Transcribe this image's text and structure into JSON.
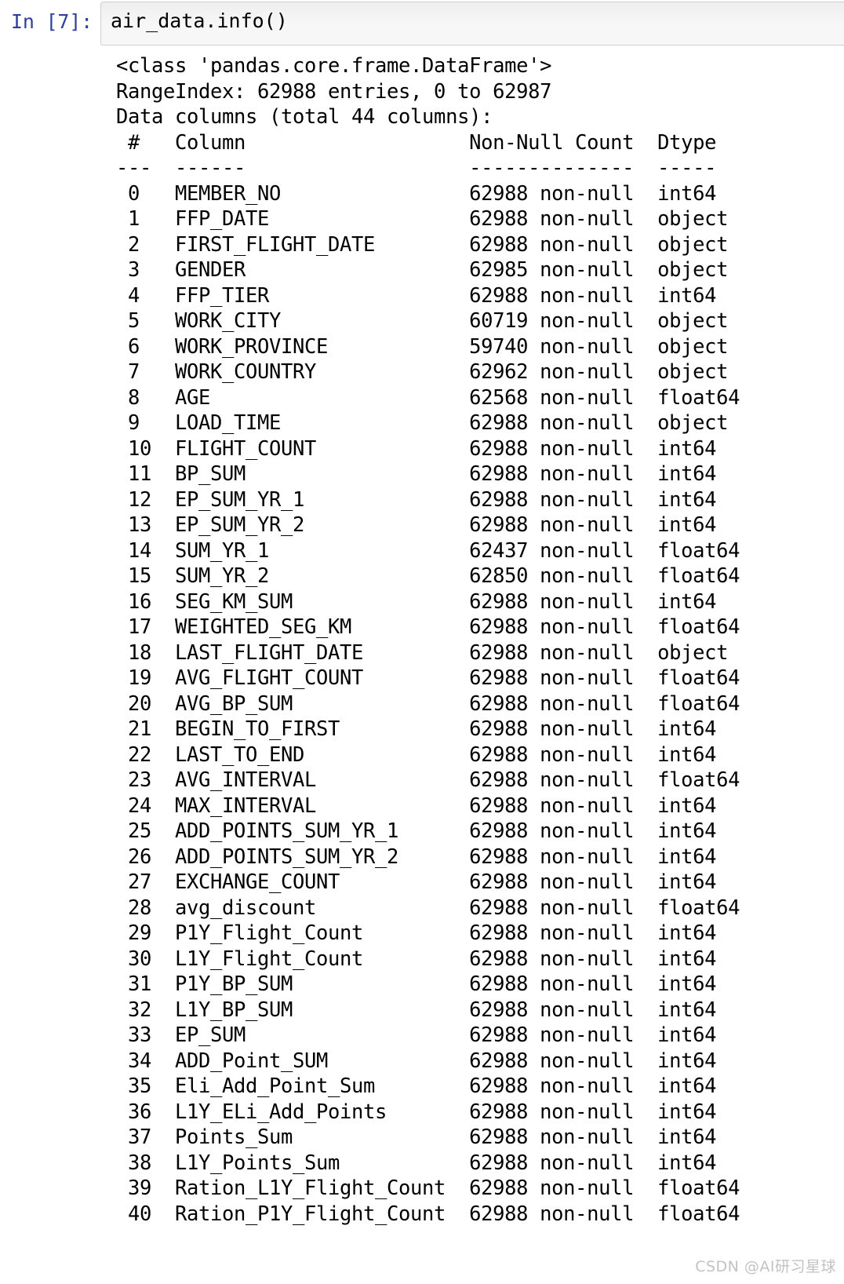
{
  "cell": {
    "prompt_label": "In [7]:",
    "prompt_color": "#303f9f",
    "input_code": "air_data.info()"
  },
  "output": {
    "header_lines": [
      "<class 'pandas.core.frame.DataFrame'>",
      "RangeIndex: 62988 entries, 0 to 62987",
      "Data columns (total 44 columns):"
    ],
    "table_header": " #   Column                  Non-Null Count  Dtype  ",
    "table_rule": "---  ------                  --------------  -----  ",
    "columns_header_labels": [
      "#",
      "Column",
      "Non-Null Count",
      "Dtype"
    ],
    "rows": [
      {
        "index": "0",
        "column": "MEMBER_NO",
        "non_null": "62988 non-null",
        "dtype": "int64"
      },
      {
        "index": "1",
        "column": "FFP_DATE",
        "non_null": "62988 non-null",
        "dtype": "object"
      },
      {
        "index": "2",
        "column": "FIRST_FLIGHT_DATE",
        "non_null": "62988 non-null",
        "dtype": "object"
      },
      {
        "index": "3",
        "column": "GENDER",
        "non_null": "62985 non-null",
        "dtype": "object"
      },
      {
        "index": "4",
        "column": "FFP_TIER",
        "non_null": "62988 non-null",
        "dtype": "int64"
      },
      {
        "index": "5",
        "column": "WORK_CITY",
        "non_null": "60719 non-null",
        "dtype": "object"
      },
      {
        "index": "6",
        "column": "WORK_PROVINCE",
        "non_null": "59740 non-null",
        "dtype": "object"
      },
      {
        "index": "7",
        "column": "WORK_COUNTRY",
        "non_null": "62962 non-null",
        "dtype": "object"
      },
      {
        "index": "8",
        "column": "AGE",
        "non_null": "62568 non-null",
        "dtype": "float64"
      },
      {
        "index": "9",
        "column": "LOAD_TIME",
        "non_null": "62988 non-null",
        "dtype": "object"
      },
      {
        "index": "10",
        "column": "FLIGHT_COUNT",
        "non_null": "62988 non-null",
        "dtype": "int64"
      },
      {
        "index": "11",
        "column": "BP_SUM",
        "non_null": "62988 non-null",
        "dtype": "int64"
      },
      {
        "index": "12",
        "column": "EP_SUM_YR_1",
        "non_null": "62988 non-null",
        "dtype": "int64"
      },
      {
        "index": "13",
        "column": "EP_SUM_YR_2",
        "non_null": "62988 non-null",
        "dtype": "int64"
      },
      {
        "index": "14",
        "column": "SUM_YR_1",
        "non_null": "62437 non-null",
        "dtype": "float64"
      },
      {
        "index": "15",
        "column": "SUM_YR_2",
        "non_null": "62850 non-null",
        "dtype": "float64"
      },
      {
        "index": "16",
        "column": "SEG_KM_SUM",
        "non_null": "62988 non-null",
        "dtype": "int64"
      },
      {
        "index": "17",
        "column": "WEIGHTED_SEG_KM",
        "non_null": "62988 non-null",
        "dtype": "float64"
      },
      {
        "index": "18",
        "column": "LAST_FLIGHT_DATE",
        "non_null": "62988 non-null",
        "dtype": "object"
      },
      {
        "index": "19",
        "column": "AVG_FLIGHT_COUNT",
        "non_null": "62988 non-null",
        "dtype": "float64"
      },
      {
        "index": "20",
        "column": "AVG_BP_SUM",
        "non_null": "62988 non-null",
        "dtype": "float64"
      },
      {
        "index": "21",
        "column": "BEGIN_TO_FIRST",
        "non_null": "62988 non-null",
        "dtype": "int64"
      },
      {
        "index": "22",
        "column": "LAST_TO_END",
        "non_null": "62988 non-null",
        "dtype": "int64"
      },
      {
        "index": "23",
        "column": "AVG_INTERVAL",
        "non_null": "62988 non-null",
        "dtype": "float64"
      },
      {
        "index": "24",
        "column": "MAX_INTERVAL",
        "non_null": "62988 non-null",
        "dtype": "int64"
      },
      {
        "index": "25",
        "column": "ADD_POINTS_SUM_YR_1",
        "non_null": "62988 non-null",
        "dtype": "int64"
      },
      {
        "index": "26",
        "column": "ADD_POINTS_SUM_YR_2",
        "non_null": "62988 non-null",
        "dtype": "int64"
      },
      {
        "index": "27",
        "column": "EXCHANGE_COUNT",
        "non_null": "62988 non-null",
        "dtype": "int64"
      },
      {
        "index": "28",
        "column": "avg_discount",
        "non_null": "62988 non-null",
        "dtype": "float64"
      },
      {
        "index": "29",
        "column": "P1Y_Flight_Count",
        "non_null": "62988 non-null",
        "dtype": "int64"
      },
      {
        "index": "30",
        "column": "L1Y_Flight_Count",
        "non_null": "62988 non-null",
        "dtype": "int64"
      },
      {
        "index": "31",
        "column": "P1Y_BP_SUM",
        "non_null": "62988 non-null",
        "dtype": "int64"
      },
      {
        "index": "32",
        "column": "L1Y_BP_SUM",
        "non_null": "62988 non-null",
        "dtype": "int64"
      },
      {
        "index": "33",
        "column": "EP_SUM",
        "non_null": "62988 non-null",
        "dtype": "int64"
      },
      {
        "index": "34",
        "column": "ADD_Point_SUM",
        "non_null": "62988 non-null",
        "dtype": "int64"
      },
      {
        "index": "35",
        "column": "Eli_Add_Point_Sum",
        "non_null": "62988 non-null",
        "dtype": "int64"
      },
      {
        "index": "36",
        "column": "L1Y_ELi_Add_Points",
        "non_null": "62988 non-null",
        "dtype": "int64"
      },
      {
        "index": "37",
        "column": "Points_Sum",
        "non_null": "62988 non-null",
        "dtype": "int64"
      },
      {
        "index": "38",
        "column": "L1Y_Points_Sum",
        "non_null": "62988 non-null",
        "dtype": "int64"
      },
      {
        "index": "39",
        "column": "Ration_L1Y_Flight_Count",
        "non_null": "62988 non-null",
        "dtype": "float64"
      },
      {
        "index": "40",
        "column": "Ration_P1Y_Flight_Count",
        "non_null": "62988 non-null",
        "dtype": "float64"
      }
    ],
    "full_text": "<class 'pandas.core.frame.DataFrame'>\nRangeIndex: 62988 entries, 0 to 62987\nData columns (total 44 columns):\n #   Column                   Non-Null Count  Dtype  \n---  ------                   --------------  -----  \n 0   MEMBER_NO                62988 non-null  int64  \n 1   FFP_DATE                 62988 non-null  object \n 2   FIRST_FLIGHT_DATE        62988 non-null  object \n 3   GENDER                   62985 non-null  object \n 4   FFP_TIER                 62988 non-null  int64  \n 5   WORK_CITY                60719 non-null  object \n 6   WORK_PROVINCE            59740 non-null  object \n 7   WORK_COUNTRY             62962 non-null  object \n 8   AGE                      62568 non-null  float64\n 9   LOAD_TIME                62988 non-null  object \n 10  FLIGHT_COUNT             62988 non-null  int64  \n 11  BP_SUM                   62988 non-null  int64  \n 12  EP_SUM_YR_1              62988 non-null  int64  \n 13  EP_SUM_YR_2              62988 non-null  int64  \n 14  SUM_YR_1                 62437 non-null  float64\n 15  SUM_YR_2                 62850 non-null  float64\n 16  SEG_KM_SUM               62988 non-null  int64  \n 17  WEIGHTED_SEG_KM          62988 non-null  float64\n 18  LAST_FLIGHT_DATE         62988 non-null  object \n 19  AVG_FLIGHT_COUNT         62988 non-null  float64\n 20  AVG_BP_SUM               62988 non-null  float64\n 21  BEGIN_TO_FIRST           62988 non-null  int64  \n 22  LAST_TO_END              62988 non-null  int64  \n 23  AVG_INTERVAL             62988 non-null  float64\n 24  MAX_INTERVAL             62988 non-null  int64  \n 25  ADD_POINTS_SUM_YR_1      62988 non-null  int64  \n 26  ADD_POINTS_SUM_YR_2      62988 non-null  int64  \n 27  EXCHANGE_COUNT           62988 non-null  int64  \n 28  avg_discount             62988 non-null  float64\n 29  P1Y_Flight_Count         62988 non-null  int64  \n 30  L1Y_Flight_Count         62988 non-null  int64  \n 31  P1Y_BP_SUM               62988 non-null  int64  \n 32  L1Y_BP_SUM               62988 non-null  int64  \n 33  EP_SUM                   62988 non-null  int64  \n 34  ADD_Point_SUM            62988 non-null  int64  \n 35  Eli_Add_Point_Sum        62988 non-null  int64  \n 36  L1Y_ELi_Add_Points       62988 non-null  int64  \n 37  Points_Sum               62988 non-null  int64  \n 38  L1Y_Points_Sum           62988 non-null  int64  \n 39  Ration_L1Y_Flight_Count  62988 non-null  float64\n 40  Ration_P1Y_Flight_Count  62988 non-null  float64"
  },
  "watermark": {
    "text": "CSDN @AI研习星球"
  }
}
